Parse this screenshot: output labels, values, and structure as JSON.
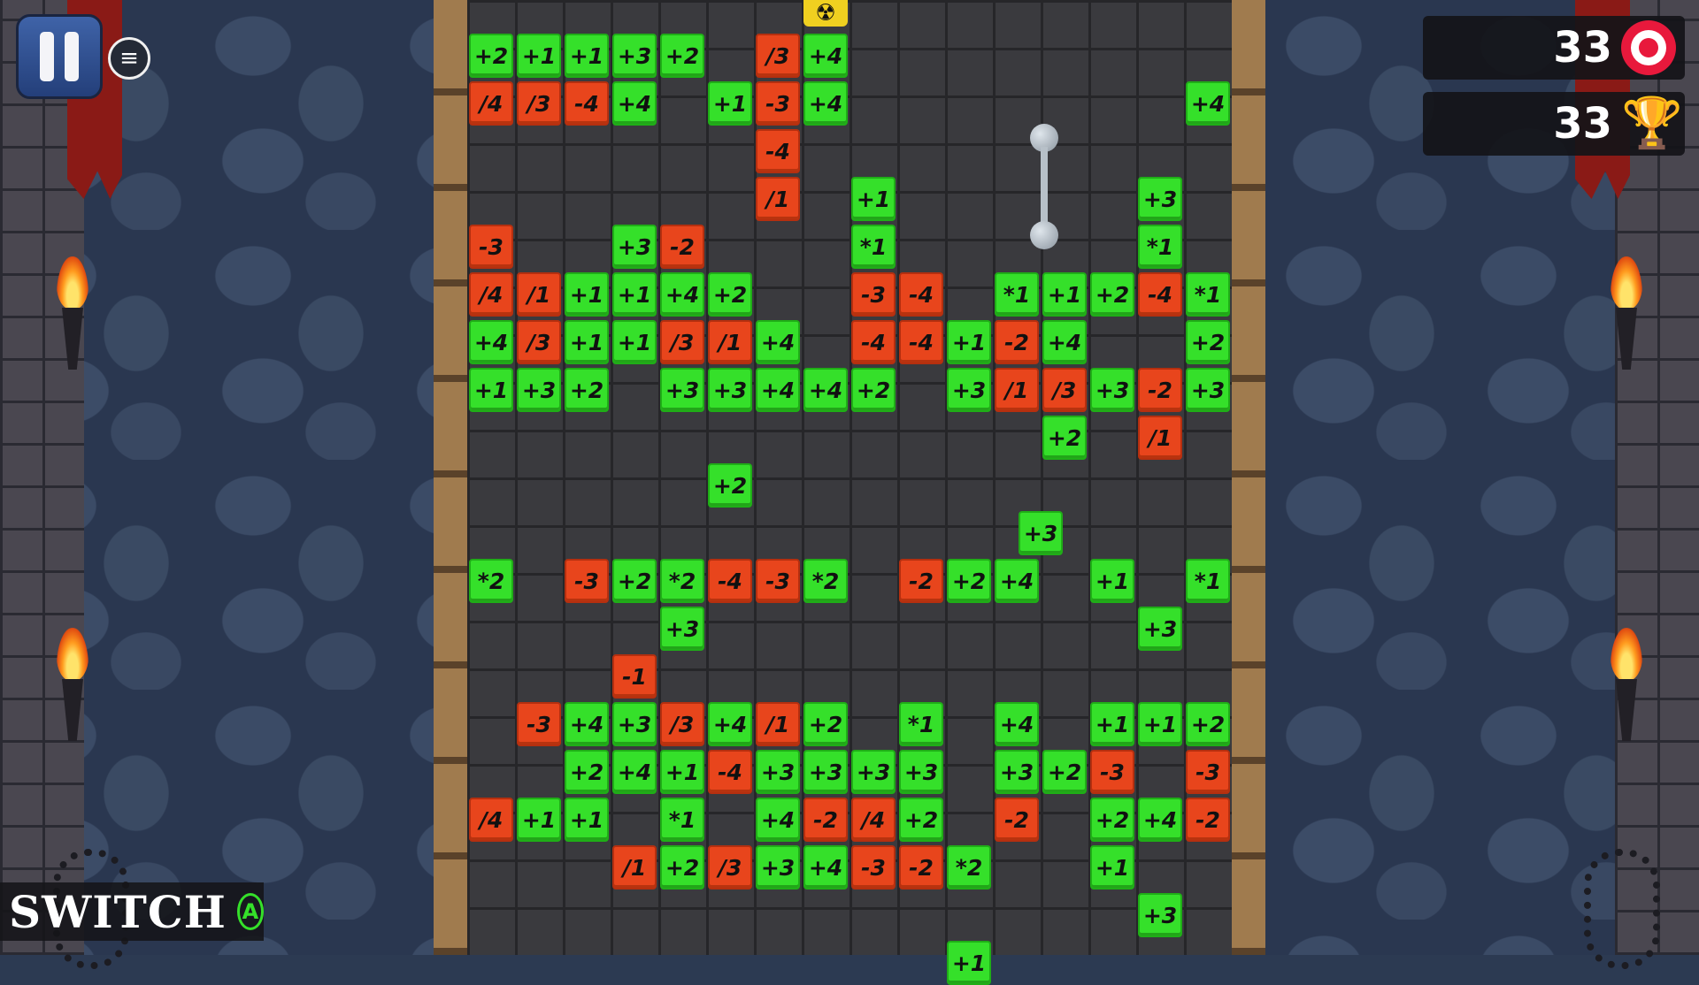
{
  "hud": {
    "target_score": "33",
    "best_score": "33",
    "switch_label": "SWITCH",
    "switch_button": "A",
    "menu_icon": "≡",
    "trophy_icon": "🏆"
  },
  "icons": {
    "pause": "pause-icon",
    "menu": "hamburger-menu-icon",
    "target": "target-icon",
    "trophy": "trophy-icon",
    "radioactive": "radioactive-icon",
    "mace": "mace-icon"
  },
  "colors": {
    "positive": "#35e02a",
    "negative": "#e8451c",
    "hazard": "#f0d020"
  },
  "board": {
    "tiles": [
      {
        "row": 0,
        "col": 0,
        "text": "+2",
        "kind": "g"
      },
      {
        "row": 0,
        "col": 1,
        "text": "+1",
        "kind": "g"
      },
      {
        "row": 0,
        "col": 2,
        "text": "+1",
        "kind": "g"
      },
      {
        "row": 0,
        "col": 3,
        "text": "+3",
        "kind": "g"
      },
      {
        "row": 0,
        "col": 4,
        "text": "+2",
        "kind": "g"
      },
      {
        "row": 0,
        "col": 6,
        "text": "/3",
        "kind": "r"
      },
      {
        "row": 0,
        "col": 7,
        "text": "+4",
        "kind": "g"
      },
      {
        "row": 1,
        "col": 0,
        "text": "/4",
        "kind": "r"
      },
      {
        "row": 1,
        "col": 1,
        "text": "/3",
        "kind": "r"
      },
      {
        "row": 1,
        "col": 2,
        "text": "-4",
        "kind": "r"
      },
      {
        "row": 1,
        "col": 3,
        "text": "+4",
        "kind": "g"
      },
      {
        "row": 1,
        "col": 5,
        "text": "+1",
        "kind": "g"
      },
      {
        "row": 1,
        "col": 6,
        "text": "-3",
        "kind": "r"
      },
      {
        "row": 1,
        "col": 7,
        "text": "+4",
        "kind": "g"
      },
      {
        "row": 1,
        "col": 15,
        "text": "+4",
        "kind": "g"
      },
      {
        "row": 2,
        "col": 6,
        "text": "-4",
        "kind": "r"
      },
      {
        "row": 3,
        "col": 6,
        "text": "/1",
        "kind": "r"
      },
      {
        "row": 3,
        "col": 8,
        "text": "+1",
        "kind": "g"
      },
      {
        "row": 3,
        "col": 14,
        "text": "+3",
        "kind": "g"
      },
      {
        "row": 4,
        "col": 0,
        "text": "-3",
        "kind": "r"
      },
      {
        "row": 4,
        "col": 3,
        "text": "+3",
        "kind": "g"
      },
      {
        "row": 4,
        "col": 4,
        "text": "-2",
        "kind": "r"
      },
      {
        "row": 4,
        "col": 8,
        "text": "*1",
        "kind": "g"
      },
      {
        "row": 4,
        "col": 14,
        "text": "*1",
        "kind": "g"
      },
      {
        "row": 5,
        "col": 0,
        "text": "/4",
        "kind": "r"
      },
      {
        "row": 5,
        "col": 1,
        "text": "/1",
        "kind": "r"
      },
      {
        "row": 5,
        "col": 2,
        "text": "+1",
        "kind": "g"
      },
      {
        "row": 5,
        "col": 3,
        "text": "+1",
        "kind": "g"
      },
      {
        "row": 5,
        "col": 4,
        "text": "+4",
        "kind": "g"
      },
      {
        "row": 5,
        "col": 5,
        "text": "+2",
        "kind": "g"
      },
      {
        "row": 5,
        "col": 8,
        "text": "-3",
        "kind": "r"
      },
      {
        "row": 5,
        "col": 9,
        "text": "-4",
        "kind": "r"
      },
      {
        "row": 5,
        "col": 11,
        "text": "*1",
        "kind": "g"
      },
      {
        "row": 5,
        "col": 12,
        "text": "+1",
        "kind": "g"
      },
      {
        "row": 5,
        "col": 13,
        "text": "+2",
        "kind": "g"
      },
      {
        "row": 5,
        "col": 14,
        "text": "-4",
        "kind": "r"
      },
      {
        "row": 5,
        "col": 15,
        "text": "*1",
        "kind": "g"
      },
      {
        "row": 6,
        "col": 0,
        "text": "+4",
        "kind": "g"
      },
      {
        "row": 6,
        "col": 1,
        "text": "/3",
        "kind": "r"
      },
      {
        "row": 6,
        "col": 2,
        "text": "+1",
        "kind": "g"
      },
      {
        "row": 6,
        "col": 3,
        "text": "+1",
        "kind": "g"
      },
      {
        "row": 6,
        "col": 4,
        "text": "/3",
        "kind": "r"
      },
      {
        "row": 6,
        "col": 5,
        "text": "/1",
        "kind": "r"
      },
      {
        "row": 6,
        "col": 6,
        "text": "+4",
        "kind": "g"
      },
      {
        "row": 6,
        "col": 8,
        "text": "-4",
        "kind": "r"
      },
      {
        "row": 6,
        "col": 9,
        "text": "-4",
        "kind": "r"
      },
      {
        "row": 6,
        "col": 10,
        "text": "+1",
        "kind": "g"
      },
      {
        "row": 6,
        "col": 11,
        "text": "-2",
        "kind": "r"
      },
      {
        "row": 6,
        "col": 12,
        "text": "+4",
        "kind": "g"
      },
      {
        "row": 6,
        "col": 15,
        "text": "+2",
        "kind": "g"
      },
      {
        "row": 7,
        "col": 0,
        "text": "+1",
        "kind": "g"
      },
      {
        "row": 7,
        "col": 1,
        "text": "+3",
        "kind": "g"
      },
      {
        "row": 7,
        "col": 2,
        "text": "+2",
        "kind": "g"
      },
      {
        "row": 7,
        "col": 4,
        "text": "+3",
        "kind": "g"
      },
      {
        "row": 7,
        "col": 5,
        "text": "+3",
        "kind": "g"
      },
      {
        "row": 7,
        "col": 6,
        "text": "+4",
        "kind": "g"
      },
      {
        "row": 7,
        "col": 7,
        "text": "+4",
        "kind": "g"
      },
      {
        "row": 7,
        "col": 8,
        "text": "+2",
        "kind": "g"
      },
      {
        "row": 7,
        "col": 10,
        "text": "+3",
        "kind": "g"
      },
      {
        "row": 7,
        "col": 11,
        "text": "/1",
        "kind": "r"
      },
      {
        "row": 7,
        "col": 12,
        "text": "/3",
        "kind": "r"
      },
      {
        "row": 7,
        "col": 13,
        "text": "+3",
        "kind": "g"
      },
      {
        "row": 7,
        "col": 14,
        "text": "-2",
        "kind": "r"
      },
      {
        "row": 7,
        "col": 15,
        "text": "+3",
        "kind": "g"
      },
      {
        "row": 8,
        "col": 12,
        "text": "+2",
        "kind": "g"
      },
      {
        "row": 8,
        "col": 14,
        "text": "/1",
        "kind": "r"
      },
      {
        "row": 9,
        "col": 5,
        "text": "+2",
        "kind": "g"
      },
      {
        "row": 10,
        "col": 11.5,
        "text": "+3",
        "kind": "g"
      },
      {
        "row": 11,
        "col": 0,
        "text": "*2",
        "kind": "g"
      },
      {
        "row": 11,
        "col": 2,
        "text": "-3",
        "kind": "r"
      },
      {
        "row": 11,
        "col": 3,
        "text": "+2",
        "kind": "g"
      },
      {
        "row": 11,
        "col": 4,
        "text": "*2",
        "kind": "g"
      },
      {
        "row": 11,
        "col": 5,
        "text": "-4",
        "kind": "r"
      },
      {
        "row": 11,
        "col": 6,
        "text": "-3",
        "kind": "r"
      },
      {
        "row": 11,
        "col": 7,
        "text": "*2",
        "kind": "g"
      },
      {
        "row": 11,
        "col": 9,
        "text": "-2",
        "kind": "r"
      },
      {
        "row": 11,
        "col": 10,
        "text": "+2",
        "kind": "g"
      },
      {
        "row": 11,
        "col": 11,
        "text": "+4",
        "kind": "g"
      },
      {
        "row": 11,
        "col": 13,
        "text": "+1",
        "kind": "g"
      },
      {
        "row": 11,
        "col": 15,
        "text": "*1",
        "kind": "g"
      },
      {
        "row": 12,
        "col": 4,
        "text": "+3",
        "kind": "g"
      },
      {
        "row": 12,
        "col": 14,
        "text": "+3",
        "kind": "g"
      },
      {
        "row": 13,
        "col": 3,
        "text": "-1",
        "kind": "r"
      },
      {
        "row": 14,
        "col": 1,
        "text": "-3",
        "kind": "r"
      },
      {
        "row": 14,
        "col": 2,
        "text": "+4",
        "kind": "g"
      },
      {
        "row": 14,
        "col": 3,
        "text": "+3",
        "kind": "g"
      },
      {
        "row": 14,
        "col": 4,
        "text": "/3",
        "kind": "r"
      },
      {
        "row": 14,
        "col": 5,
        "text": "+4",
        "kind": "g"
      },
      {
        "row": 14,
        "col": 6,
        "text": "/1",
        "kind": "r"
      },
      {
        "row": 14,
        "col": 7,
        "text": "+2",
        "kind": "g"
      },
      {
        "row": 14,
        "col": 9,
        "text": "*1",
        "kind": "g"
      },
      {
        "row": 14,
        "col": 11,
        "text": "+4",
        "kind": "g"
      },
      {
        "row": 14,
        "col": 13,
        "text": "+1",
        "kind": "g"
      },
      {
        "row": 14,
        "col": 14,
        "text": "+1",
        "kind": "g"
      },
      {
        "row": 14,
        "col": 15,
        "text": "+2",
        "kind": "g"
      },
      {
        "row": 15,
        "col": 2,
        "text": "+2",
        "kind": "g"
      },
      {
        "row": 15,
        "col": 3,
        "text": "+4",
        "kind": "g"
      },
      {
        "row": 15,
        "col": 4,
        "text": "+1",
        "kind": "g"
      },
      {
        "row": 15,
        "col": 5,
        "text": "-4",
        "kind": "r"
      },
      {
        "row": 15,
        "col": 6,
        "text": "+3",
        "kind": "g"
      },
      {
        "row": 15,
        "col": 7,
        "text": "+3",
        "kind": "g"
      },
      {
        "row": 15,
        "col": 8,
        "text": "+3",
        "kind": "g"
      },
      {
        "row": 15,
        "col": 9,
        "text": "+3",
        "kind": "g"
      },
      {
        "row": 15,
        "col": 11,
        "text": "+3",
        "kind": "g"
      },
      {
        "row": 15,
        "col": 12,
        "text": "+2",
        "kind": "g"
      },
      {
        "row": 15,
        "col": 13,
        "text": "-3",
        "kind": "r"
      },
      {
        "row": 15,
        "col": 15,
        "text": "-3",
        "kind": "r"
      },
      {
        "row": 16,
        "col": 0,
        "text": "/4",
        "kind": "r"
      },
      {
        "row": 16,
        "col": 1,
        "text": "+1",
        "kind": "g"
      },
      {
        "row": 16,
        "col": 2,
        "text": "+1",
        "kind": "g"
      },
      {
        "row": 16,
        "col": 4,
        "text": "*1",
        "kind": "g"
      },
      {
        "row": 16,
        "col": 6,
        "text": "+4",
        "kind": "g"
      },
      {
        "row": 16,
        "col": 7,
        "text": "-2",
        "kind": "r"
      },
      {
        "row": 16,
        "col": 8,
        "text": "/4",
        "kind": "r"
      },
      {
        "row": 16,
        "col": 9,
        "text": "+2",
        "kind": "g"
      },
      {
        "row": 16,
        "col": 11,
        "text": "-2",
        "kind": "r"
      },
      {
        "row": 16,
        "col": 13,
        "text": "+2",
        "kind": "g"
      },
      {
        "row": 16,
        "col": 14,
        "text": "+4",
        "kind": "g"
      },
      {
        "row": 16,
        "col": 15,
        "text": "-2",
        "kind": "r"
      },
      {
        "row": 17,
        "col": 3,
        "text": "/1",
        "kind": "r"
      },
      {
        "row": 17,
        "col": 4,
        "text": "+2",
        "kind": "g"
      },
      {
        "row": 17,
        "col": 5,
        "text": "/3",
        "kind": "r"
      },
      {
        "row": 17,
        "col": 6,
        "text": "+3",
        "kind": "g"
      },
      {
        "row": 17,
        "col": 7,
        "text": "+4",
        "kind": "g"
      },
      {
        "row": 17,
        "col": 8,
        "text": "-3",
        "kind": "r"
      },
      {
        "row": 17,
        "col": 9,
        "text": "-2",
        "kind": "r"
      },
      {
        "row": 17,
        "col": 10,
        "text": "*2",
        "kind": "g"
      },
      {
        "row": 17,
        "col": 13,
        "text": "+1",
        "kind": "g"
      },
      {
        "row": 18,
        "col": 14,
        "text": "+3",
        "kind": "g"
      },
      {
        "row": 19,
        "col": 10,
        "text": "+1",
        "kind": "g"
      }
    ]
  }
}
